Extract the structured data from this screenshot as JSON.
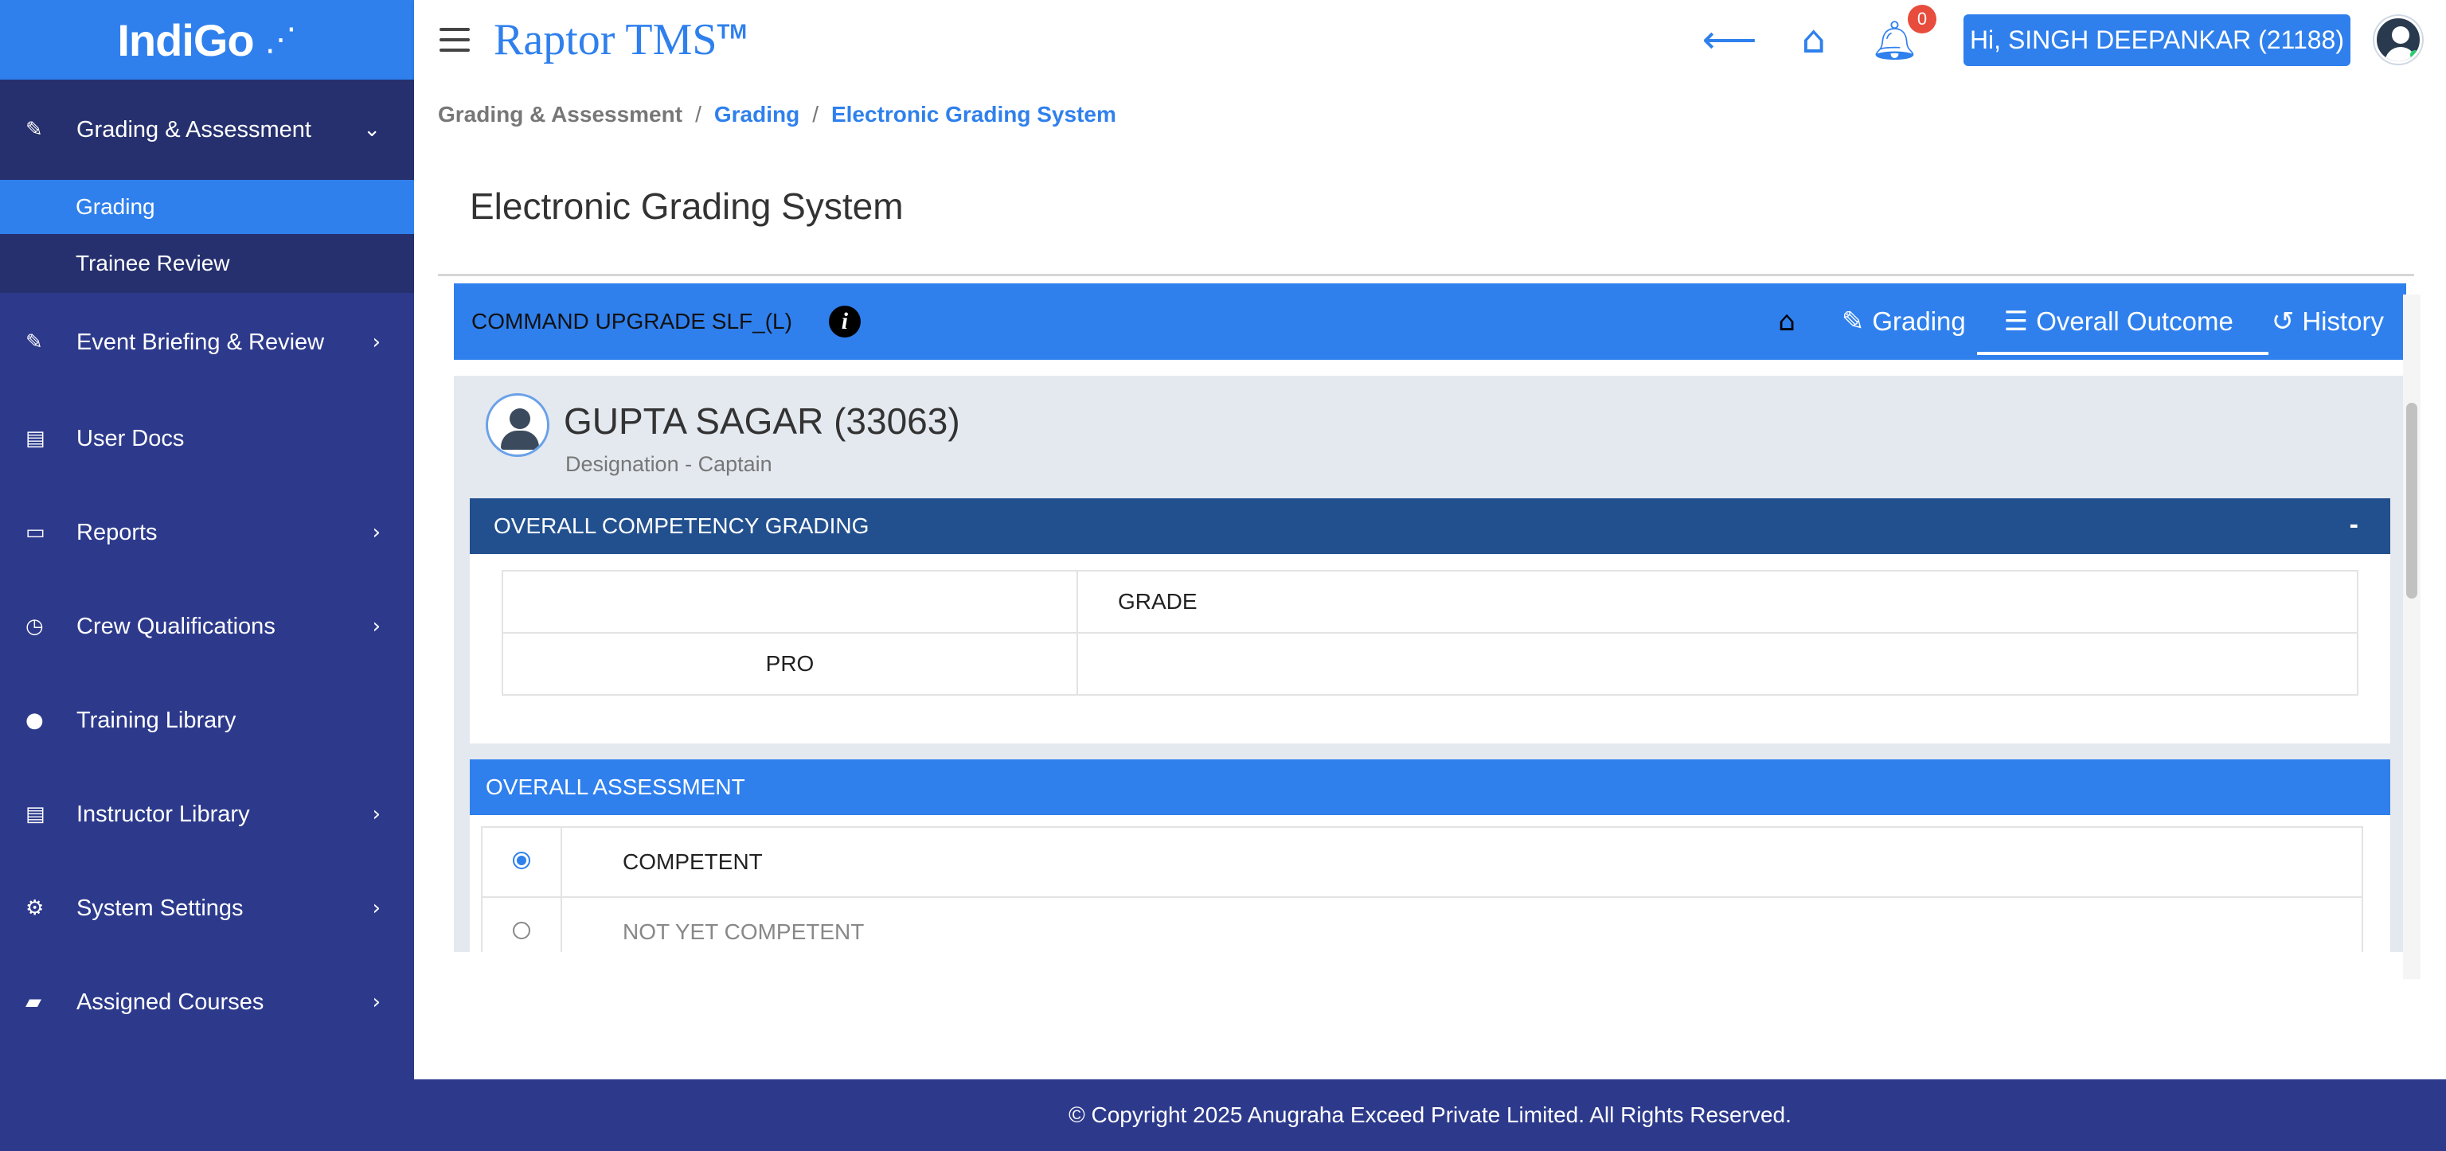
{
  "app": {
    "logo": "IndiGo",
    "brand": "Raptor TMS",
    "brand_tm": "TM"
  },
  "header": {
    "notification_count": "0",
    "user_greeting": "Hi, SINGH DEEPANKAR (21188)"
  },
  "sidebar": {
    "items": [
      {
        "label": "Grading & Assessment",
        "icon": "edit-icon",
        "expanded": true
      },
      {
        "label": "Event Briefing & Review",
        "icon": "edit-icon"
      },
      {
        "label": "User Docs",
        "icon": "document-icon"
      },
      {
        "label": "Reports",
        "icon": "report-icon"
      },
      {
        "label": "Crew Qualifications",
        "icon": "clock-icon"
      },
      {
        "label": "Training Library",
        "icon": "user-icon"
      },
      {
        "label": "Instructor Library",
        "icon": "document-icon"
      },
      {
        "label": "System Settings",
        "icon": "gears-icon"
      },
      {
        "label": "Assigned Courses",
        "icon": "folder-open-icon"
      }
    ],
    "sub_items": [
      {
        "label": "Grading",
        "active": true
      },
      {
        "label": "Trainee Review",
        "active": false
      }
    ]
  },
  "breadcrumb": {
    "items": [
      "Grading & Assessment",
      "Grading",
      "Electronic Grading System"
    ]
  },
  "page": {
    "title": "Electronic Grading System"
  },
  "course": {
    "name": "COMMAND UPGRADE SLF_(L)",
    "tabs": [
      {
        "label": "",
        "icon": "home-icon"
      },
      {
        "label": "Grading",
        "icon": "edit-icon"
      },
      {
        "label": "Overall Outcome",
        "icon": "list-icon",
        "active": true
      },
      {
        "label": "History",
        "icon": "history-icon"
      }
    ]
  },
  "trainee": {
    "name": "GUPTA SAGAR (33063)",
    "designation": "Designation - Captain"
  },
  "competency": {
    "header": "OVERALL COMPETENCY GRADING",
    "collapse_label": "-",
    "column_header": "GRADE",
    "rows": [
      {
        "label": "PRO",
        "grade": ""
      }
    ]
  },
  "assessment": {
    "header": "OVERALL ASSESSMENT",
    "options": [
      {
        "label": "COMPETENT",
        "selected": true
      },
      {
        "label": "NOT YET COMPETENT",
        "selected": false
      }
    ]
  },
  "footer": {
    "text": "© Copyright 2025 Anugraha Exceed Private Limited.  All Rights Reserved."
  },
  "colors": {
    "accent": "#2f80ed",
    "sidebar": "#2d3a8c",
    "sidebar_group": "#26306e",
    "panel_dark": "#22508f"
  }
}
